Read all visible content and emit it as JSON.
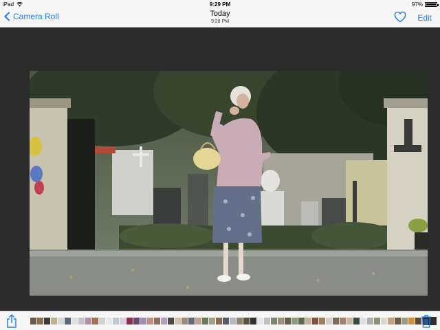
{
  "status": {
    "device": "iPad",
    "time": "9:29 PM",
    "battery": "97%",
    "battery_level": 0.97
  },
  "nav": {
    "back_label": "Camera Roll",
    "title": "Today",
    "subtitle": "9:28 PM",
    "edit_label": "Edit"
  },
  "colors": {
    "accent": "#1a7cf4",
    "bar_bg": "#f7f7f7",
    "viewer_bg": "#2b2b2b"
  },
  "icons": {
    "back": "chevron-left-icon",
    "favorite": "heart-icon",
    "share": "share-icon",
    "delete": "trash-icon"
  },
  "filmstrip": {
    "thumbs": [
      "#6a5a4a",
      "#8a7050",
      "#3a3a3a",
      "#c0b090",
      "#d8d8d8",
      "#5a6a7a",
      "#e0e0e0",
      "#c8c0d0",
      "#b090a0",
      "#a07050",
      "#d0d0d0",
      "#e8e8e8",
      "#c0c8d0",
      "#d8d0e0",
      "#903050",
      "#6a4a6a",
      "#a090b0",
      "#c09080",
      "#8a7060",
      "#b0a0c0",
      "#4a4a4a",
      "#d0c0b0",
      "#9a8a7a",
      "#606870",
      "#c0a090",
      "#6a7a5a",
      "#a0a090",
      "#8a6a50",
      "#5a5a6a",
      "#b0b8c0",
      "#908070",
      "#5a5040",
      "#303030",
      "#e8e8e8",
      "#c0c0c0",
      "#7a8a6a",
      "#a09080",
      "#6a6050",
      "#8a9a7a",
      "#5a6a4a",
      "#c0b0a0",
      "#805040",
      "#9a8060",
      "#d0d0d0",
      "#7a6a5a",
      "#a08070",
      "#c8b8a8",
      "#3a4a3a",
      "#e0e0e0",
      "#b0b0b0",
      "#8a9070",
      "#d8d8d8",
      "#c0a080",
      "#6a5a4a",
      "#9a9a8a",
      "#d09040",
      "#5a4a3a"
    ],
    "current_index": 57
  }
}
